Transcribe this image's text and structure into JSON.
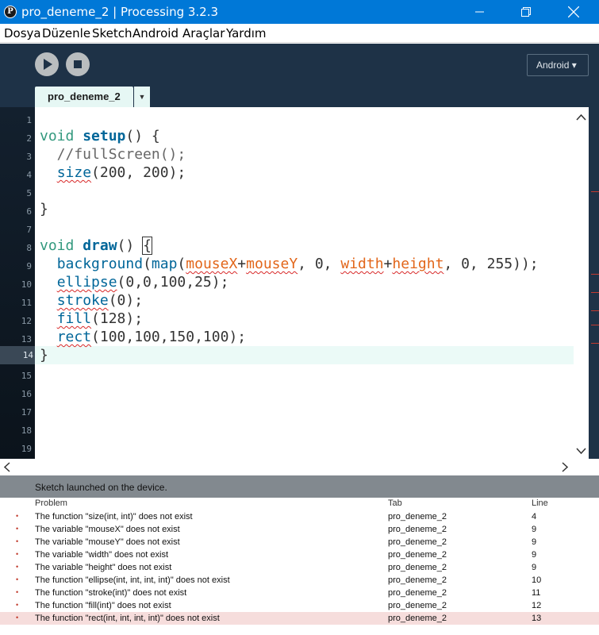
{
  "window": {
    "app_icon": "P",
    "title": "pro_deneme_2 | Processing 3.2.3"
  },
  "menu": [
    "Dosya",
    "Düzenle",
    "Sketch",
    "Android",
    "Araçlar",
    "Yardım"
  ],
  "toolbar": {
    "mode_label": "Android ▾"
  },
  "tabs": {
    "active": "pro_deneme_2",
    "menu_arrow": "▼"
  },
  "editor": {
    "line_numbers": [
      "1",
      "2",
      "3",
      "4",
      "5",
      "6",
      "7",
      "8",
      "9",
      "10",
      "11",
      "12",
      "13",
      "14",
      "15",
      "16",
      "17",
      "18",
      "19"
    ],
    "active_line": 14,
    "code": [
      "",
      "void setup() {",
      "  //fullScreen();",
      "  size(200, 200);",
      "",
      "}",
      "",
      "void draw() {",
      "  background(map(mouseX+mouseY, 0, width+height, 0, 255));",
      "  ellipse(0,0,100,25);",
      "  stroke(0);",
      "  fill(128);",
      "  rect(100,100,150,100);",
      "}"
    ]
  },
  "status": {
    "message": "Sketch launched on the device."
  },
  "problems": {
    "headers": {
      "problem": "Problem",
      "tab": "Tab",
      "line": "Line"
    },
    "rows": [
      {
        "problem": "The function \"size(int, int)\" does not exist",
        "tab": "pro_deneme_2",
        "line": "4"
      },
      {
        "problem": "The variable \"mouseX\" does not exist",
        "tab": "pro_deneme_2",
        "line": "9"
      },
      {
        "problem": "The variable \"mouseY\" does not exist",
        "tab": "pro_deneme_2",
        "line": "9"
      },
      {
        "problem": "The variable \"width\" does not exist",
        "tab": "pro_deneme_2",
        "line": "9"
      },
      {
        "problem": "The variable \"height\" does not exist",
        "tab": "pro_deneme_2",
        "line": "9"
      },
      {
        "problem": "The function \"ellipse(int, int, int, int)\" does not exist",
        "tab": "pro_deneme_2",
        "line": "10"
      },
      {
        "problem": "The function \"stroke(int)\" does not exist",
        "tab": "pro_deneme_2",
        "line": "11"
      },
      {
        "problem": "The function \"fill(int)\" does not exist",
        "tab": "pro_deneme_2",
        "line": "12"
      },
      {
        "problem": "The function \"rect(int, int, int, int)\" does not exist",
        "tab": "pro_deneme_2",
        "line": "13"
      }
    ],
    "selected_row": 8
  },
  "colors": {
    "titlebar": "#0078d7",
    "header": "#1e3247",
    "keyword": "#33997e",
    "function": "#006699",
    "error_underline": "#d82828"
  }
}
